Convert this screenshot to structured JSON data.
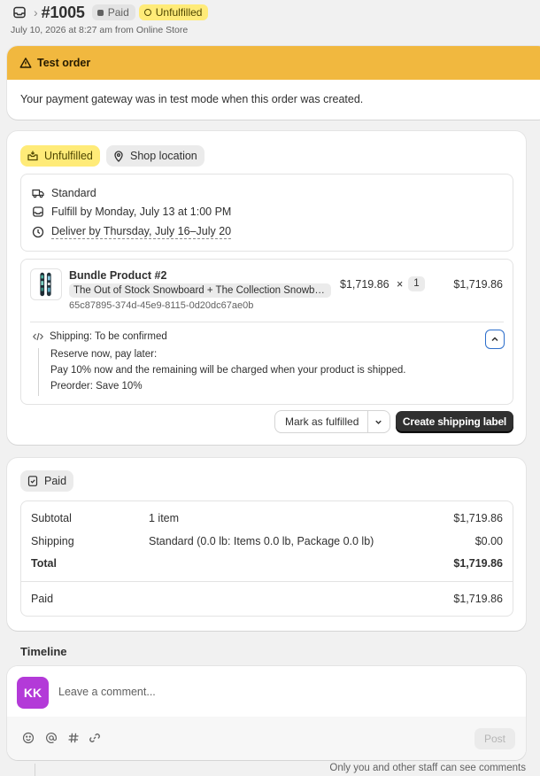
{
  "header": {
    "order_number": "#1005",
    "payment_badge": "Paid",
    "fulfillment_badge": "Unfulfilled",
    "meta": "July 10, 2026 at 8:27 am from Online Store"
  },
  "test_banner": {
    "title": "Test order",
    "message": "Your payment gateway was in test mode when this order was created."
  },
  "fulfillment_card": {
    "status_label": "Unfulfilled",
    "location_label": "Shop location",
    "shipping": {
      "method": "Standard",
      "fulfill_by": "Fulfill by Monday, July 13 at 1:00 PM",
      "deliver_by": "Deliver by Thursday, July 16–July 20"
    },
    "line_item": {
      "product_name": "Bundle Product #2",
      "variant": "The Out of Stock Snowboard + The Collection Snowb…",
      "sku": "65c87895-374d-45e9-8115-0d20dc67ae0b",
      "unit_price": "$1,719.86",
      "times": "×",
      "quantity": "1",
      "line_total": "$1,719.86",
      "shipping_status": "Shipping: To be confirmed",
      "preorder_lines": [
        "Reserve now, pay later:",
        "Pay 10% now and the remaining will be charged when your product is shipped.",
        "Preorder: Save 10%"
      ]
    },
    "mark_fulfilled_label": "Mark as fulfilled",
    "create_label_button": "Create shipping label"
  },
  "payment_card": {
    "status_label": "Paid",
    "rows": [
      {
        "label": "Subtotal",
        "detail": "1 item",
        "amount": "$1,719.86"
      },
      {
        "label": "Shipping",
        "detail": "Standard (0.0 lb: Items 0.0 lb, Package 0.0 lb)",
        "amount": "$0.00"
      },
      {
        "label": "Total",
        "detail": "",
        "amount": "$1,719.86"
      }
    ],
    "paid_row": {
      "label": "Paid",
      "amount": "$1,719.86"
    }
  },
  "timeline": {
    "title": "Timeline",
    "avatar_initials": "KK",
    "comment_placeholder": "Leave a comment...",
    "post_label": "Post",
    "visibility_note": "Only you and other staff can see comments"
  },
  "colors": {
    "banner": "#f1b83f",
    "unfulfilled_badge": "#ffeb78",
    "avatar": "#b33ad8",
    "primary_button": "#303030"
  }
}
